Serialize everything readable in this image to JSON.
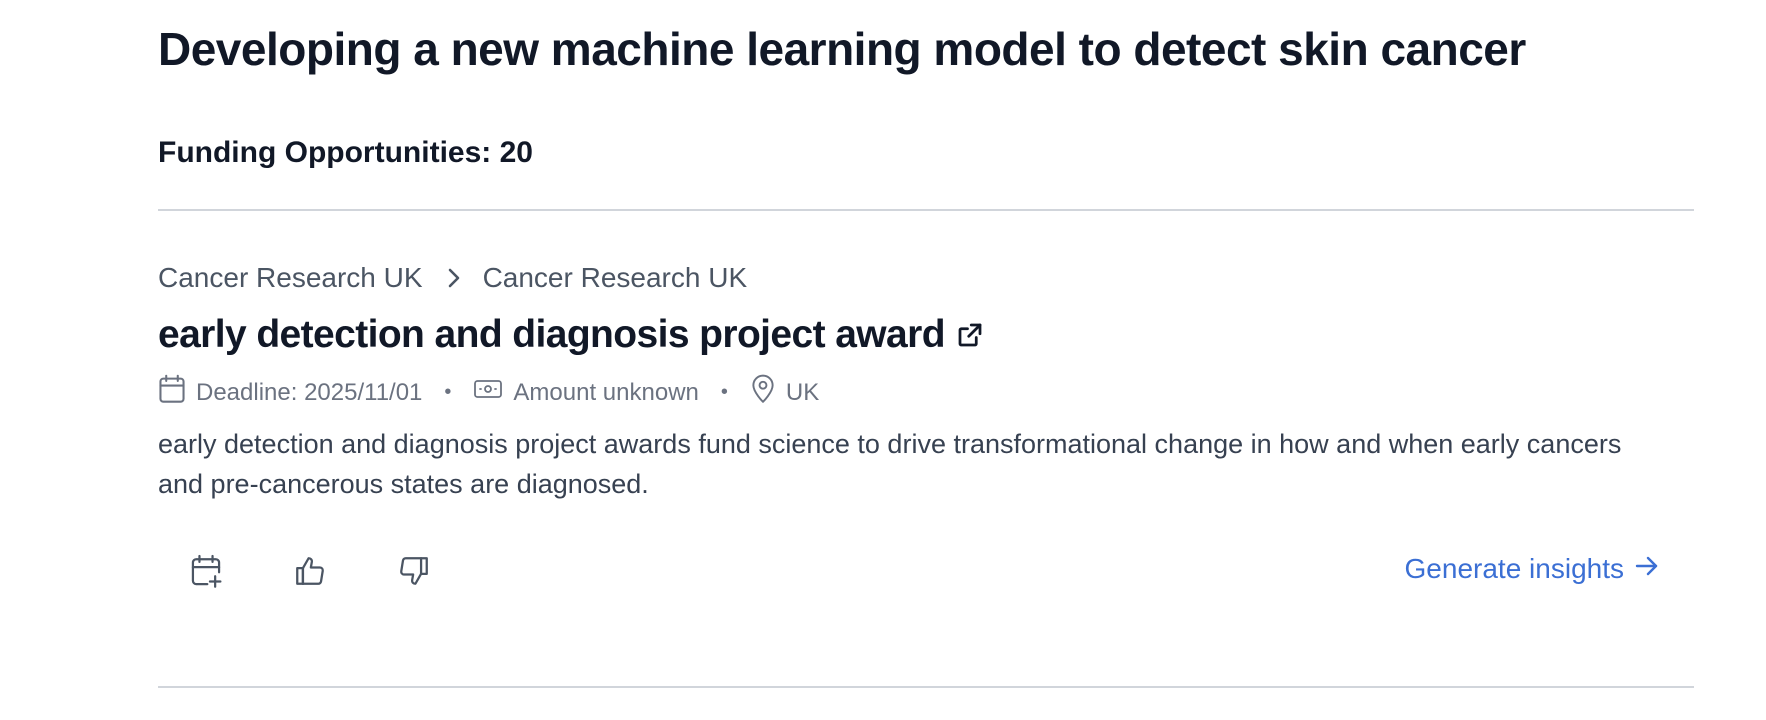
{
  "project": {
    "title": "Developing a new machine learning model to detect skin cancer",
    "funding_count_label": "Funding Opportunities: 20"
  },
  "opportunity": {
    "breadcrumb": [
      "Cancer Research UK",
      "Cancer Research UK"
    ],
    "title": "early detection and diagnosis project award",
    "deadline": "Deadline: 2025/11/01",
    "amount": "Amount unknown",
    "location": "UK",
    "description": "early detection and diagnosis project awards fund science to drive transformational change in how and when early cancers and pre-cancerous states are diagnosed.",
    "actions": {
      "insights_label": "Generate insights"
    }
  },
  "icons": [
    "chevron-right-icon",
    "external-link-icon",
    "calendar-icon",
    "money-icon",
    "map-pin-icon",
    "calendar-plus-icon",
    "thumbs-up-icon",
    "thumbs-down-icon",
    "arrow-right-icon"
  ],
  "colors": {
    "title": "#111827",
    "muted": "#6b7280",
    "body_text": "#374151",
    "link": "#3b6fd4",
    "divider": "#d1d5db"
  }
}
